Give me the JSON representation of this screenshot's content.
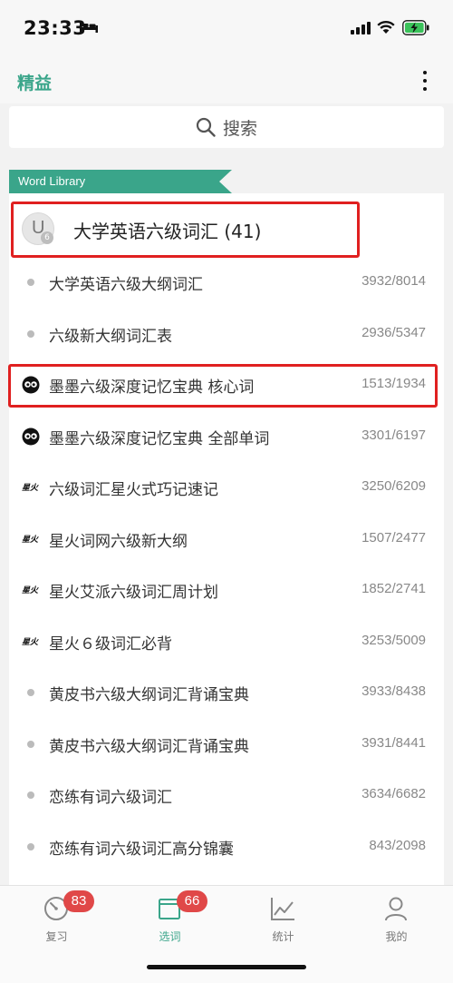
{
  "status": {
    "time": "23:33"
  },
  "nav": {
    "app_title": "精益"
  },
  "search": {
    "label": "搜索"
  },
  "library": {
    "banner": "Word Library"
  },
  "group": {
    "badge_letter": "U",
    "badge_sub": "6",
    "label": "大学英语六级词汇 (41)"
  },
  "items": [
    {
      "icon": "bullet-icon",
      "label": "大学英语六级大纲词汇",
      "count": "3932/8014"
    },
    {
      "icon": "bullet-icon",
      "label": "六级新大纲词汇表",
      "count": "2936/5347"
    },
    {
      "icon": "momo-owl-icon",
      "label": "墨墨六级深度记忆宝典 核心词",
      "count": "1513/1934"
    },
    {
      "icon": "momo-owl-icon",
      "label": "墨墨六级深度记忆宝典 全部单词",
      "count": "3301/6197"
    },
    {
      "icon": "xinghuo-logo",
      "icon_text": "星火",
      "label": "六级词汇星火式巧记速记",
      "count": "3250/6209"
    },
    {
      "icon": "xinghuo-logo",
      "icon_text": "星火",
      "label": "星火词网六级新大纲",
      "count": "1507/2477"
    },
    {
      "icon": "xinghuo-logo",
      "icon_text": "星火",
      "label": "星火艾派六级词汇周计划",
      "count": "1852/2741"
    },
    {
      "icon": "xinghuo-logo",
      "icon_text": "星火",
      "label": "星火６级词汇必背",
      "count": "3253/5009"
    },
    {
      "icon": "bullet-icon",
      "label": "黄皮书六级大纲词汇背诵宝典",
      "count": "3933/8438"
    },
    {
      "icon": "bullet-icon",
      "label": "黄皮书六级大纲词汇背诵宝典",
      "count": "3931/8441"
    },
    {
      "icon": "bullet-icon",
      "label": "恋练有词六级词汇",
      "count": "3634/6682"
    },
    {
      "icon": "bullet-icon",
      "label": "恋练有词六级词汇高分锦囊",
      "count": "843/2098"
    }
  ],
  "tabs": [
    {
      "label": "复习",
      "badge": "83",
      "icon": "gauge-icon"
    },
    {
      "label": "选词",
      "badge": "66",
      "icon": "book-icon",
      "active": true
    },
    {
      "label": "统计",
      "icon": "chart-icon"
    },
    {
      "label": "我的",
      "icon": "person-icon"
    }
  ],
  "colors": {
    "accent": "#3aa58a",
    "highlight": "#e02020",
    "badge": "#e04848"
  }
}
